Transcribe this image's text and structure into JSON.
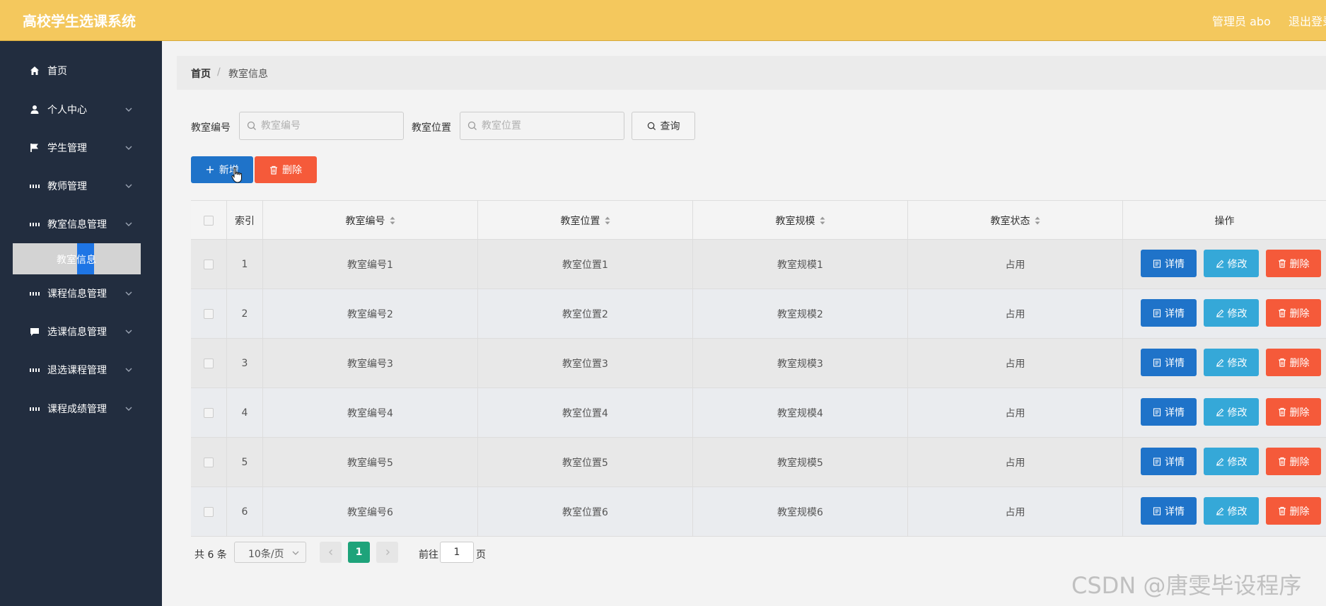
{
  "header": {
    "title": "高校学生选课系统",
    "user": "管理员 abo",
    "logout": "退出登录"
  },
  "sidebar": {
    "items": [
      {
        "label": "首页",
        "icon": "home-icon"
      },
      {
        "label": "个人中心",
        "icon": "user-icon"
      },
      {
        "label": "学生管理",
        "icon": "flag-icon"
      },
      {
        "label": "教师管理",
        "icon": "grid-icon"
      },
      {
        "label": "教室信息管理",
        "icon": "grid-icon"
      },
      {
        "label": "课程信息管理",
        "icon": "grid-icon"
      },
      {
        "label": "选课信息管理",
        "icon": "chat-icon"
      },
      {
        "label": "退选课程管理",
        "icon": "grid-icon"
      },
      {
        "label": "课程成绩管理",
        "icon": "grid-icon"
      }
    ],
    "active_sub": "教室信息"
  },
  "breadcrumb": {
    "home": "首页",
    "separator": "/",
    "current": "教室信息"
  },
  "search": {
    "field1_label": "教室编号",
    "field1_placeholder": "教室编号",
    "field2_label": "教室位置",
    "field2_placeholder": "教室位置",
    "query_button": "查询"
  },
  "toolbar": {
    "add_label": "新增",
    "delete_label": "删除"
  },
  "table": {
    "columns": [
      "索引",
      "教室编号",
      "教室位置",
      "教室规模",
      "教室状态",
      "操作"
    ],
    "rows": [
      {
        "index": "1",
        "code": "教室编号1",
        "location": "教室位置1",
        "scale": "教室规模1",
        "status": "占用"
      },
      {
        "index": "2",
        "code": "教室编号2",
        "location": "教室位置2",
        "scale": "教室规模2",
        "status": "占用"
      },
      {
        "index": "3",
        "code": "教室编号3",
        "location": "教室位置3",
        "scale": "教室规模3",
        "status": "占用"
      },
      {
        "index": "4",
        "code": "教室编号4",
        "location": "教室位置4",
        "scale": "教室规模4",
        "status": "占用"
      },
      {
        "index": "5",
        "code": "教室编号5",
        "location": "教室位置5",
        "scale": "教室规模5",
        "status": "占用"
      },
      {
        "index": "6",
        "code": "教室编号6",
        "location": "教室位置6",
        "scale": "教室规模6",
        "status": "占用"
      }
    ],
    "actions": {
      "detail": "详情",
      "edit": "修改",
      "delete": "删除"
    }
  },
  "pagination": {
    "total": "共 6 条",
    "page_size": "10条/页",
    "current_page": "1",
    "goto_label": "前往",
    "goto_value": "1",
    "goto_suffix": "页"
  },
  "watermark": "CSDN @唐雯毕设程序",
  "colors": {
    "header_bg": "#f4c85d",
    "sidebar_bg": "#222d3f",
    "primary": "#1f73c9",
    "info": "#35a8d8",
    "danger": "#f55a3a",
    "pager_active": "#1ea37a"
  }
}
